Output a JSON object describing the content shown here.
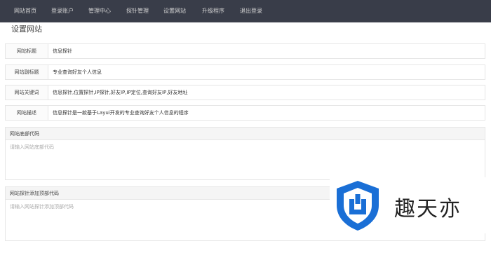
{
  "nav": {
    "items": [
      {
        "label": "网站首页"
      },
      {
        "label": "登录账户"
      },
      {
        "label": "管理中心"
      },
      {
        "label": "探针管理"
      },
      {
        "label": "设置网站"
      },
      {
        "label": "升级程序"
      },
      {
        "label": "退出登录"
      }
    ]
  },
  "page": {
    "title": "设置网站"
  },
  "form": {
    "fields": [
      {
        "label": "网站标题",
        "value": "信息探针"
      },
      {
        "label": "网站副标题",
        "value": "专业查询好友个人信息"
      },
      {
        "label": "网站关键词",
        "value": "信息探针,位置探针,IP探针,好友IP,IP定位,查询好友IP,好友地址"
      },
      {
        "label": "网站描述",
        "value": "信息探针是一款基于Layui开发的专业查询好友个人信息的程序"
      }
    ],
    "footer_code": {
      "label": "网站底部代码",
      "placeholder": "请输入网站底部代码"
    },
    "top_code": {
      "label": "网站探针添加顶部代码",
      "placeholder": "请输入网站探针添加顶部代码"
    }
  },
  "watermark": {
    "text": "趣天亦",
    "logo_color": "#1a6fd6"
  }
}
